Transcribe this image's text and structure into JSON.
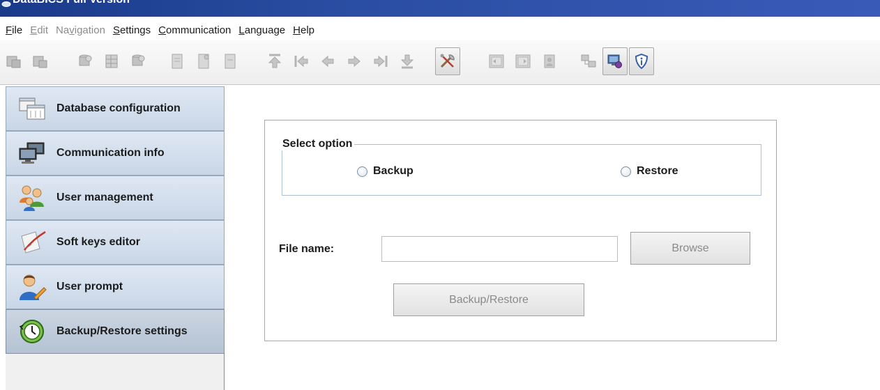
{
  "window": {
    "title": "DataBICS Full Version"
  },
  "menu": [
    {
      "label": "File",
      "underline": "F",
      "rest": "ile",
      "enabled": true
    },
    {
      "label": "Edit",
      "underline": "E",
      "rest": "dit",
      "enabled": false
    },
    {
      "label": "Navigation",
      "pre": "Na",
      "underline": "v",
      "rest": "igation",
      "enabled": false
    },
    {
      "label": "Settings",
      "underline": "S",
      "rest": "ettings",
      "enabled": true
    },
    {
      "label": "Communication",
      "underline": "C",
      "rest": "ommunication",
      "enabled": true
    },
    {
      "label": "Language",
      "underline": "L",
      "rest": "anguage",
      "enabled": true
    },
    {
      "label": "Help",
      "underline": "H",
      "rest": "elp",
      "enabled": true
    }
  ],
  "toolbar": {
    "icons": [
      "copy-record-icon",
      "paste-record-icon",
      "db-add-icon",
      "db-table-icon",
      "db-remove-icon",
      "doc-new-icon",
      "doc-edit-icon",
      "doc-delete-icon",
      "first-record-icon",
      "prev-page-icon",
      "prev-record-icon",
      "next-record-icon",
      "last-record-icon",
      "download-icon",
      "tools-icon",
      "import-icon",
      "export-icon",
      "user-doc-icon",
      "network-icon",
      "display-settings-icon",
      "shield-info-icon"
    ]
  },
  "sidebar": {
    "items": [
      {
        "label": "Database configuration",
        "icon": "database-config-icon"
      },
      {
        "label": "Communication info",
        "icon": "computers-icon"
      },
      {
        "label": "User management",
        "icon": "users-icon"
      },
      {
        "label": "Soft keys editor",
        "icon": "feather-scroll-icon"
      },
      {
        "label": "User prompt",
        "icon": "user-edit-icon"
      },
      {
        "label": "Backup/Restore settings",
        "icon": "restore-clock-icon"
      }
    ],
    "active_index": 5
  },
  "panel": {
    "legend": "Select option",
    "radio_backup": "Backup",
    "radio_restore": "Restore",
    "file_label": "File name:",
    "file_value": "",
    "browse_label": "Browse",
    "action_label": "Backup/Restore"
  },
  "colors": {
    "titlebar": "#2a4ea3",
    "nav_bg": "#c9d6e6",
    "field_border": "#a9c0d6",
    "disabled_text": "#8a8a8a"
  }
}
